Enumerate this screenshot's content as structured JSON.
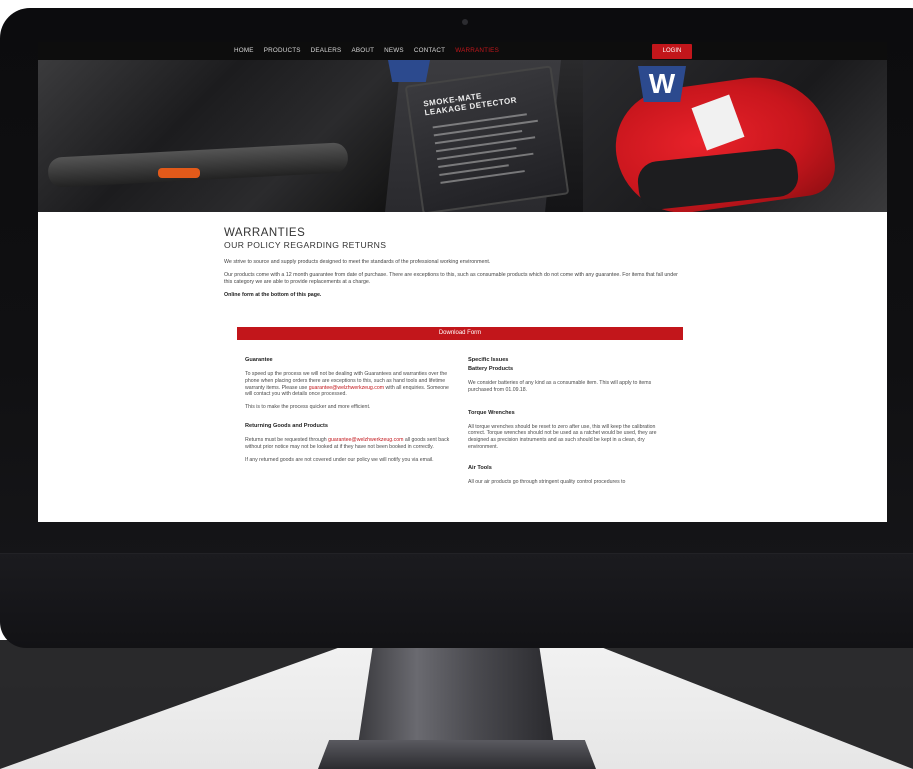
{
  "nav": {
    "items": [
      {
        "label": "HOME"
      },
      {
        "label": "PRODUCTS"
      },
      {
        "label": "DEALERS"
      },
      {
        "label": "ABOUT"
      },
      {
        "label": "NEWS"
      },
      {
        "label": "CONTACT"
      },
      {
        "label": "WARRANTIES",
        "active": true
      }
    ],
    "login_label": "LOGIN"
  },
  "hero": {
    "card_title_line1": "SMOKE-MATE",
    "card_title_line2": "LEAKAGE DETECTOR",
    "logo_letter": "W"
  },
  "page": {
    "title": "WARRANTIES",
    "subtitle": "OUR POLICY REGARDING RETURNS",
    "intro_1": "We strive to source and supply products designed to meet the standards of the professional working environment.",
    "intro_2": "Our products come with a 12 month guarantee from date of purchase. There are exceptions to this, such as consumable products which do not come with any guarantee. For items that fall under this category we are able to provide replacements at a charge.",
    "intro_note": "Online form at the bottom of this page.",
    "download_label": "Download Form"
  },
  "left_column": {
    "guarantee_heading": "Guarantee",
    "guarantee_p1_before": "To speed up the process we will not be dealing with Guarantees and warranties over the phone when placing orders there are exceptions to this, such as hand tools and lifetime warranty items. Please use ",
    "guarantee_email": "guarantee@welzhwerkzeug.com",
    "guarantee_p1_after": " with all enquiries. Someone will contact you with details once processed.",
    "guarantee_p2": "This is to make the process quicker and more efficient.",
    "returns_heading": "Returning Goods and Products",
    "returns_p1_before": "Returns must be requested through ",
    "returns_email": "guarantee@welzhwerkzeug.com",
    "returns_p1_after": " all goods sent back without prior notice may not be looked at if they have not been booked in correctly.",
    "returns_p2": "If any returned goods are not covered under our policy we will notify you via email."
  },
  "right_column": {
    "specific_heading": "Specific Issues",
    "battery_heading": "Battery Products",
    "battery_p": "We consider batteries of any kind as a consumable item. This will apply to items purchased from 01.09.18.",
    "torque_heading": "Torque Wrenches",
    "torque_p": "All torque wrenches should be reset to zero after use, this will keep the calibration correct. Torque wrenches should not be used as a ratchet would be used, they are designed as precision instruments and as such should be kept in a clean, dry environment.",
    "air_heading": "Air Tools",
    "air_p": "All our air products go through stringent quality control procedures to"
  },
  "colors": {
    "accent": "#c2161b",
    "nav_bg": "#0d0d0d",
    "logo_blue": "#2c4a8e"
  }
}
